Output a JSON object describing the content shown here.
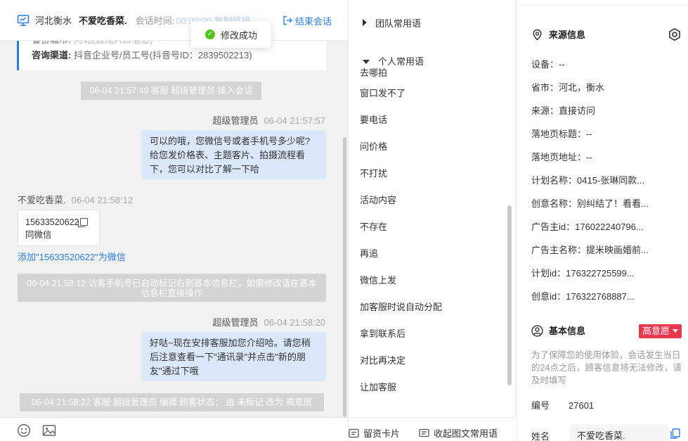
{
  "header": {
    "location": "河北衡水",
    "visitor_name": "不爱吃香菜.",
    "session_time_label": "会话时间:",
    "session_time_value": "00:00:00 复制链接",
    "end_session": "结束会话"
  },
  "toast": {
    "text": "修改成功"
  },
  "info_card": {
    "row1_key": "省份城市:",
    "row1_value": "河北(直观入口信息)",
    "row2_key": "咨询渠道:",
    "row2_value": "抖音企业号/员工号(抖音号ID：2839502213)"
  },
  "chat": {
    "messages": [
      {
        "type": "system",
        "text": "06-04 21:57:49 客服 超级管理员 接入会话"
      },
      {
        "type": "sender",
        "name": "超级管理员",
        "time": "06-04 21:57:57"
      },
      {
        "type": "outgoing",
        "text": "可以的哦，您微信号或者手机号多少呢?给您发价格表、主题客片、拍摄流程看下，您可以对比了解一下哈"
      },
      {
        "type": "sender",
        "name": "不爱吃香菜.",
        "time": "06-04 21:58:12"
      },
      {
        "type": "card",
        "number": "15633520622",
        "label": "同微信"
      },
      {
        "type": "link",
        "text": "添加\"15633520622\"为微信"
      },
      {
        "type": "system",
        "text": "06-04 21:58:12 访客手机号已自动标记右侧基本信息栏，如需修改请在基本信息栏直接操作"
      },
      {
        "type": "sender",
        "name": "超级管理员",
        "time": "06-04 21:58:20"
      },
      {
        "type": "outgoing",
        "text": "好哒~现在安排客服加您介绍哈。请您稍后注意查看一下\"通讯录\"并点击\"新的朋友\"通过下哦"
      },
      {
        "type": "system",
        "text": "06-04 21:58:22 客服 超级管理员 编辑 顾客状态： 由 未标记 改为 高意愿"
      }
    ]
  },
  "toolbar": {
    "emoji_icon": "smiley-icon",
    "image_icon": "image-icon"
  },
  "phrases": {
    "team_group": "团队常用语",
    "personal_group": "个人常用语",
    "items": [
      "去哪拍",
      "窗口发不了",
      "要电话",
      "问价格",
      "不打扰",
      "活动内容",
      "不存在",
      "再追",
      "微信上发",
      "加客服时说自动分配",
      "拿到联系后",
      "对比再决定",
      "让加客服"
    ],
    "footer_card": "留资卡片",
    "footer_collect": "收起图文常用语"
  },
  "source_info": {
    "title": "来源信息",
    "rows": [
      "设备：--",
      "省市：河北，衡水",
      "来源：直接访问",
      "落地页标题：--",
      "落地页地址：--",
      "计划名称：0415-张琳同款...",
      "创意名称：别纠结了！看看...",
      "广告主id：176022240796...",
      "广告主名称：提米映画婚前...",
      "计划id：176322725599...",
      "创意id：176322768887..."
    ]
  },
  "basic_info": {
    "title": "基本信息",
    "intent_badge": "高意愿",
    "note": "为了保障您的使用体验，会话发生当日的24点之后，顾客信息将无法修改，请及时填写",
    "id_label": "编号",
    "id_value": "27601",
    "name_label": "姓名",
    "name_value": "不爱吃香菜."
  },
  "colors": {
    "accent": "#2f7de1",
    "outgoing_bubble": "#dbe8fb",
    "system_msg": "#d4d4d4",
    "intent_red": "#e8384f",
    "success_green": "#52c41a"
  }
}
